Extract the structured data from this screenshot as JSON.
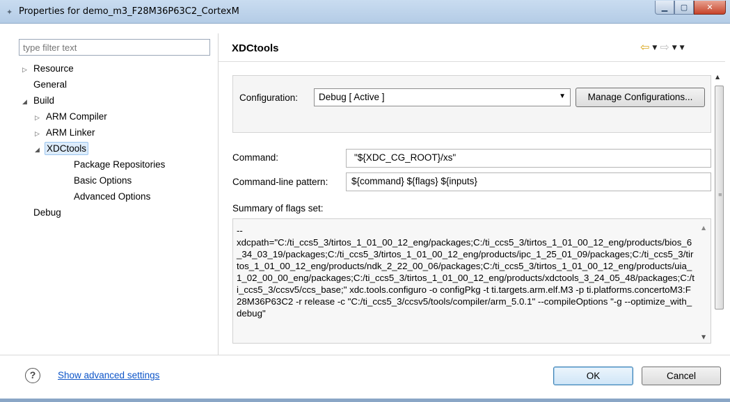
{
  "window": {
    "title": "Properties for demo_m3_F28M36P63C2_CortexM",
    "minimize": "▁",
    "maximize": "▢",
    "close": "✕"
  },
  "sidebar": {
    "filter_placeholder": "type filter text",
    "tree": [
      {
        "label": "Resource",
        "level": 0,
        "expander": "collapsed"
      },
      {
        "label": "General",
        "level": 0,
        "expander": "none"
      },
      {
        "label": "Build",
        "level": 0,
        "expander": "expanded"
      },
      {
        "label": "ARM Compiler",
        "level": 1,
        "expander": "collapsed"
      },
      {
        "label": "ARM Linker",
        "level": 1,
        "expander": "collapsed"
      },
      {
        "label": "XDCtools",
        "level": 1,
        "expander": "expanded",
        "selected": true
      },
      {
        "label": "Package Repositories",
        "level": 2,
        "expander": "none"
      },
      {
        "label": "Basic Options",
        "level": 2,
        "expander": "none"
      },
      {
        "label": "Advanced Options",
        "level": 2,
        "expander": "none"
      },
      {
        "label": "Debug",
        "level": 0,
        "expander": "none"
      }
    ]
  },
  "main": {
    "title": "XDCtools",
    "configuration_label": "Configuration:",
    "configuration_value": "Debug  [ Active ]",
    "manage_button": "Manage Configurations...",
    "command_label": "Command:",
    "command_value": "\"${XDC_CG_ROOT}/xs\"",
    "pattern_label": "Command-line pattern:",
    "pattern_value": "${command} ${flags} ${inputs}",
    "summary_label": "Summary of flags set:",
    "summary_text": "--\nxdcpath=\"C:/ti_ccs5_3/tirtos_1_01_00_12_eng/packages;C:/ti_ccs5_3/tirtos_1_01_00_12_eng/products/bios_6_34_03_19/packages;C:/ti_ccs5_3/tirtos_1_01_00_12_eng/products/ipc_1_25_01_09/packages;C:/ti_ccs5_3/tirtos_1_01_00_12_eng/products/ndk_2_22_00_06/packages;C:/ti_ccs5_3/tirtos_1_01_00_12_eng/products/uia_1_02_00_00_eng/packages;C:/ti_ccs5_3/tirtos_1_01_00_12_eng/products/xdctools_3_24_05_48/packages;C:/ti_ccs5_3/ccsv5/ccs_base;\" xdc.tools.configuro -o configPkg -t ti.targets.arm.elf.M3 -p ti.platforms.concertoM3:F28M36P63C2 -r release -c \"C:/ti_ccs5_3/ccsv5/tools/compiler/arm_5.0.1\" --compileOptions \"-g --optimize_with_debug\""
  },
  "footer": {
    "help_icon": "?",
    "advanced_link": "Show advanced settings",
    "ok": "OK",
    "cancel": "Cancel"
  },
  "icons": {
    "expand_collapsed": "▷",
    "expand_expanded": "◢",
    "back": "⇦",
    "forward": "⇨",
    "dropdown": "▼"
  }
}
